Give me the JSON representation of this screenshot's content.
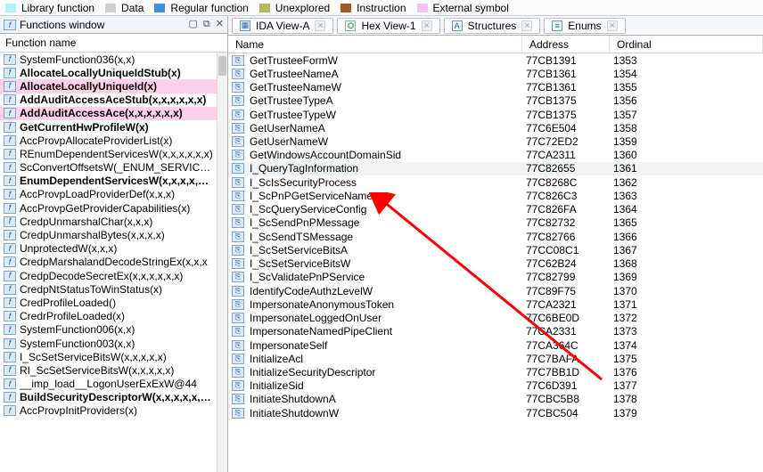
{
  "legend": {
    "lib": "Library function",
    "data": "Data",
    "reg": "Regular function",
    "unex": "Unexplored",
    "instr": "Instruction",
    "ext": "External symbol"
  },
  "left": {
    "title": "Functions window",
    "column": "Function name",
    "rows": [
      {
        "label": "SystemFunction036(x,x)",
        "bold": false,
        "pink": false
      },
      {
        "label": "AllocateLocallyUniqueIdStub(x)",
        "bold": true,
        "pink": false
      },
      {
        "label": "AllocateLocallyUniqueId(x)",
        "bold": true,
        "pink": true
      },
      {
        "label": "AddAuditAccessAceStub(x,x,x,x,x,x)",
        "bold": true,
        "pink": false
      },
      {
        "label": "AddAuditAccessAce(x,x,x,x,x,x)",
        "bold": true,
        "pink": true
      },
      {
        "label": "GetCurrentHwProfileW(x)",
        "bold": true,
        "pink": false
      },
      {
        "label": "AccProvpAllocateProviderList(x)",
        "bold": false,
        "pink": false
      },
      {
        "label": "REnumDependentServicesW(x,x,x,x,x,x)",
        "bold": false,
        "pink": false
      },
      {
        "label": "ScConvertOffsetsW(_ENUM_SERVICE_ST",
        "bold": false,
        "pink": false
      },
      {
        "label": "EnumDependentServicesW(x,x,x,x,x,x)",
        "bold": true,
        "pink": false
      },
      {
        "label": "AccProvpLoadProviderDef(x,x,x)",
        "bold": false,
        "pink": false
      },
      {
        "label": "AccProvpGetProviderCapabilities(x)",
        "bold": false,
        "pink": false
      },
      {
        "label": "CredpUnmarshalChar(x,x,x)",
        "bold": false,
        "pink": false
      },
      {
        "label": "CredpUnmarshalBytes(x,x,x,x)",
        "bold": false,
        "pink": false
      },
      {
        "label": "UnprotectedW(x,x,x)",
        "bold": false,
        "pink": false
      },
      {
        "label": "CredpMarshalandDecodeStringEx(x,x,x",
        "bold": false,
        "pink": false
      },
      {
        "label": "CredpDecodeSecretEx(x,x,x,x,x,x)",
        "bold": false,
        "pink": false
      },
      {
        "label": "CredpNtStatusToWinStatus(x)",
        "bold": false,
        "pink": false
      },
      {
        "label": "CredProfileLoaded()",
        "bold": false,
        "pink": false
      },
      {
        "label": "CredrProfileLoaded(x)",
        "bold": false,
        "pink": false
      },
      {
        "label": "SystemFunction006(x,x)",
        "bold": false,
        "pink": false
      },
      {
        "label": "SystemFunction003(x,x)",
        "bold": false,
        "pink": false
      },
      {
        "label": "I_ScSetServiceBitsW(x,x,x,x,x)",
        "bold": false,
        "pink": false
      },
      {
        "label": "RI_ScSetServiceBitsW(x,x,x,x,x)",
        "bold": false,
        "pink": false
      },
      {
        "label": "__imp_load__LogonUserExExW@44",
        "bold": false,
        "pink": false
      },
      {
        "label": "BuildSecurityDescriptorW(x,x,x,x,x,x,x",
        "bold": true,
        "pink": false
      },
      {
        "label": "AccProvpInitProviders(x)",
        "bold": false,
        "pink": false
      }
    ]
  },
  "right": {
    "tabs": [
      {
        "icon": "ida",
        "label": "IDA View-A",
        "closable": true
      },
      {
        "icon": "hex",
        "label": "Hex View-1",
        "closable": true
      },
      {
        "icon": "struct",
        "label": "Structures",
        "closable": true
      },
      {
        "icon": "enum",
        "label": "Enums",
        "closable": true
      }
    ],
    "columns": {
      "name": "Name",
      "addr": "Address",
      "ord": "Ordinal"
    },
    "rows": [
      {
        "name": "GetTrusteeFormW",
        "addr": "77CB1391",
        "ord": "1353",
        "sel": false
      },
      {
        "name": "GetTrusteeNameA",
        "addr": "77CB1361",
        "ord": "1354",
        "sel": false
      },
      {
        "name": "GetTrusteeNameW",
        "addr": "77CB1361",
        "ord": "1355",
        "sel": false
      },
      {
        "name": "GetTrusteeTypeA",
        "addr": "77CB1375",
        "ord": "1356",
        "sel": false
      },
      {
        "name": "GetTrusteeTypeW",
        "addr": "77CB1375",
        "ord": "1357",
        "sel": false
      },
      {
        "name": "GetUserNameA",
        "addr": "77C6E504",
        "ord": "1358",
        "sel": false
      },
      {
        "name": "GetUserNameW",
        "addr": "77C72ED2",
        "ord": "1359",
        "sel": false
      },
      {
        "name": "GetWindowsAccountDomainSid",
        "addr": "77CA2311",
        "ord": "1360",
        "sel": false
      },
      {
        "name": "I_QueryTagInformation",
        "addr": "77C82655",
        "ord": "1361",
        "sel": true
      },
      {
        "name": "I_ScIsSecurityProcess",
        "addr": "77C8268C",
        "ord": "1362",
        "sel": false
      },
      {
        "name": "I_ScPnPGetServiceName",
        "addr": "77C826C3",
        "ord": "1363",
        "sel": false
      },
      {
        "name": "I_ScQueryServiceConfig",
        "addr": "77C826FA",
        "ord": "1364",
        "sel": false
      },
      {
        "name": "I_ScSendPnPMessage",
        "addr": "77C82732",
        "ord": "1365",
        "sel": false
      },
      {
        "name": "I_ScSendTSMessage",
        "addr": "77C82766",
        "ord": "1366",
        "sel": false
      },
      {
        "name": "I_ScSetServiceBitsA",
        "addr": "77CC08C1",
        "ord": "1367",
        "sel": false
      },
      {
        "name": "I_ScSetServiceBitsW",
        "addr": "77C62B24",
        "ord": "1368",
        "sel": false
      },
      {
        "name": "I_ScValidatePnPService",
        "addr": "77C82799",
        "ord": "1369",
        "sel": false
      },
      {
        "name": "IdentifyCodeAuthzLevelW",
        "addr": "77C89F75",
        "ord": "1370",
        "sel": false
      },
      {
        "name": "ImpersonateAnonymousToken",
        "addr": "77CA2321",
        "ord": "1371",
        "sel": false
      },
      {
        "name": "ImpersonateLoggedOnUser",
        "addr": "77C6BE0D",
        "ord": "1372",
        "sel": false
      },
      {
        "name": "ImpersonateNamedPipeClient",
        "addr": "77CA2331",
        "ord": "1373",
        "sel": false
      },
      {
        "name": "ImpersonateSelf",
        "addr": "77CA364C",
        "ord": "1374",
        "sel": false
      },
      {
        "name": "InitializeAcl",
        "addr": "77C7BAFA",
        "ord": "1375",
        "sel": false
      },
      {
        "name": "InitializeSecurityDescriptor",
        "addr": "77C7BB1D",
        "ord": "1376",
        "sel": false
      },
      {
        "name": "InitializeSid",
        "addr": "77C6D391",
        "ord": "1377",
        "sel": false
      },
      {
        "name": "InitiateShutdownA",
        "addr": "77CBC5B8",
        "ord": "1378",
        "sel": false
      },
      {
        "name": "InitiateShutdownW",
        "addr": "77CBC504",
        "ord": "1379",
        "sel": false
      }
    ]
  },
  "icons": {
    "func_glyph": "f",
    "export_glyph": "⎘"
  }
}
